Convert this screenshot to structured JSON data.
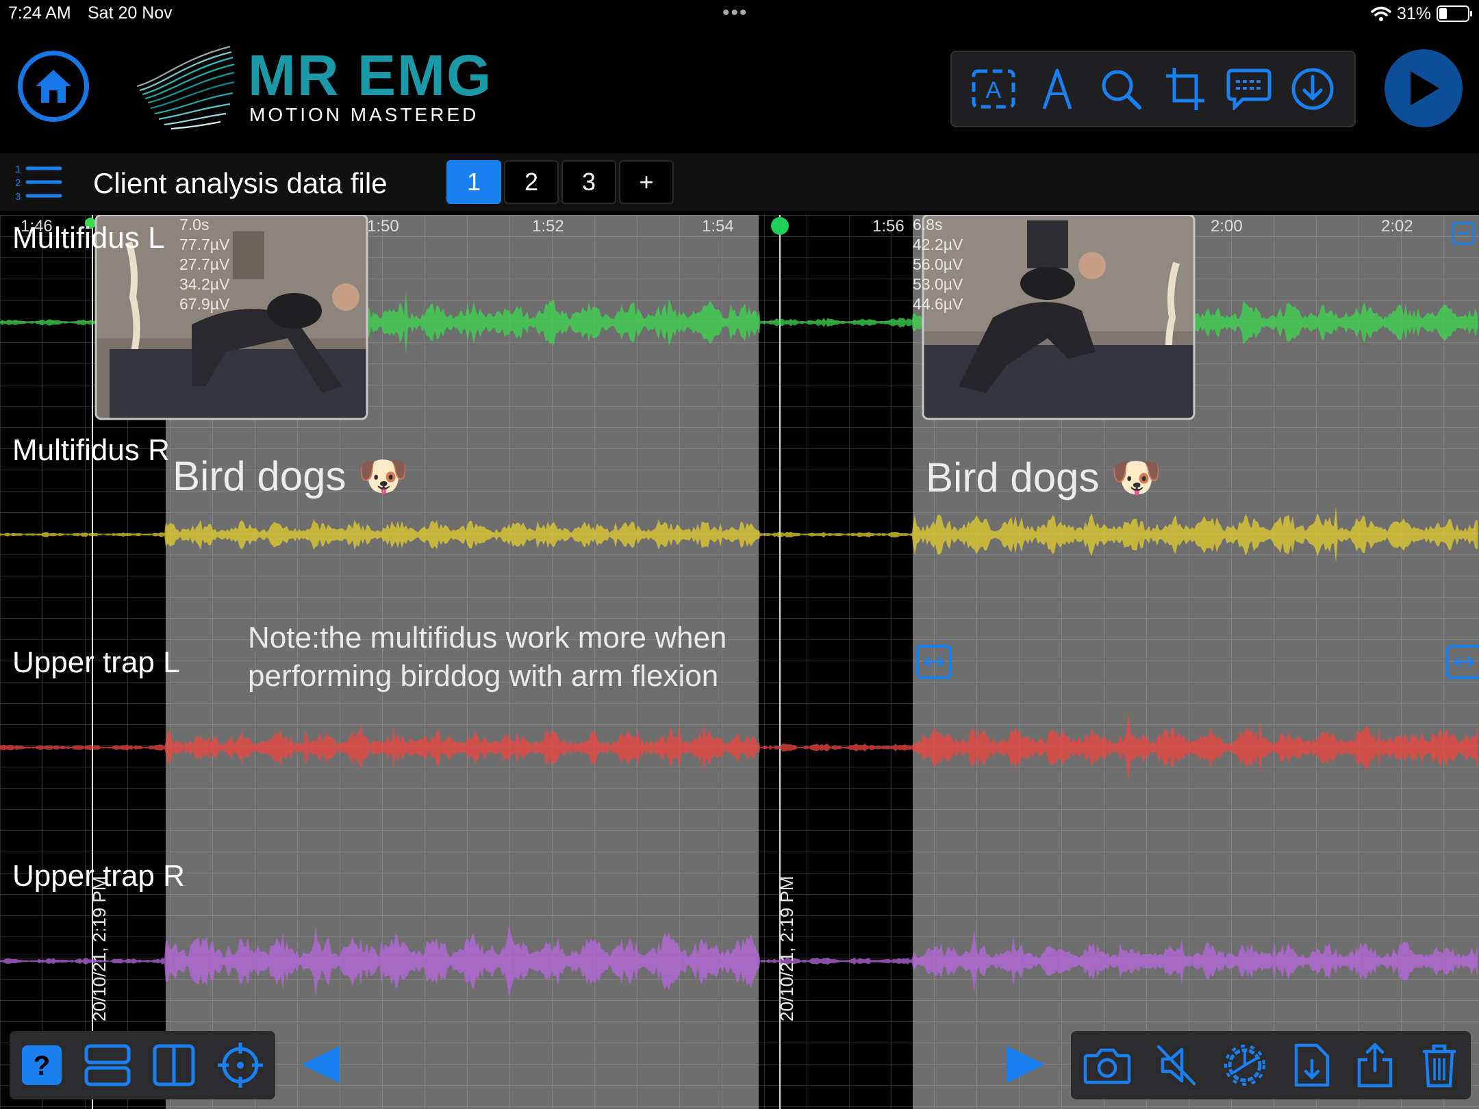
{
  "status": {
    "time": "7:24 AM",
    "date": "Sat 20 Nov",
    "battery": "31%",
    "battery_level": 0.31,
    "dots": "•••"
  },
  "brand": {
    "title": "MR EMG",
    "subtitle": "MOTION MASTERED"
  },
  "file": {
    "title": "Client analysis data file",
    "tabs": [
      "1",
      "2",
      "3",
      "+"
    ],
    "active_tab": 0
  },
  "time_ticks": {
    "left": [
      "1:46",
      "1:50",
      "1:52",
      "1:54"
    ],
    "right": [
      "1:56",
      "2:00",
      "2:02"
    ]
  },
  "channels": [
    {
      "label": "Multifidus L",
      "color": "#3dd84f"
    },
    {
      "label": "Multifidus R",
      "color": "#e6cf2e"
    },
    {
      "label": "Upper trap L",
      "color": "#f0473f"
    },
    {
      "label": "Upper trap R",
      "color": "#b868e0"
    }
  ],
  "segments": [
    {
      "duration": "7.0s",
      "values": [
        "77.7µV",
        "27.7µV",
        "34.2µV",
        "67.9µV"
      ],
      "title": "Bird dogs 🐶",
      "timestamp": "20/10/21, 2:19 PM"
    },
    {
      "duration": "6.8s",
      "values": [
        "42.2µV",
        "56.0µV",
        "53.0µV",
        "44.6µV"
      ],
      "title": "Bird dogs 🐶",
      "timestamp": "20/10/21, 2:19 PM"
    }
  ],
  "note": {
    "line1": "Note:the multifidus work more when",
    "line2": "performing birddog with arm flexion"
  },
  "icons": {
    "top": [
      "text-box-icon",
      "pen-icon",
      "search-icon",
      "crop-icon",
      "comment-icon",
      "download-icon"
    ],
    "bottom_left": [
      "help-icon",
      "rows-layout-icon",
      "columns-layout-icon",
      "crosshair-icon"
    ],
    "bottom_right": [
      "camera-icon",
      "mute-icon",
      "settings-icon",
      "file-import-icon",
      "share-icon",
      "trash-icon"
    ]
  },
  "colors": {
    "accent": "#1a80f0",
    "brand": "#1a9aa8",
    "highlight": "#6e6e6e"
  }
}
